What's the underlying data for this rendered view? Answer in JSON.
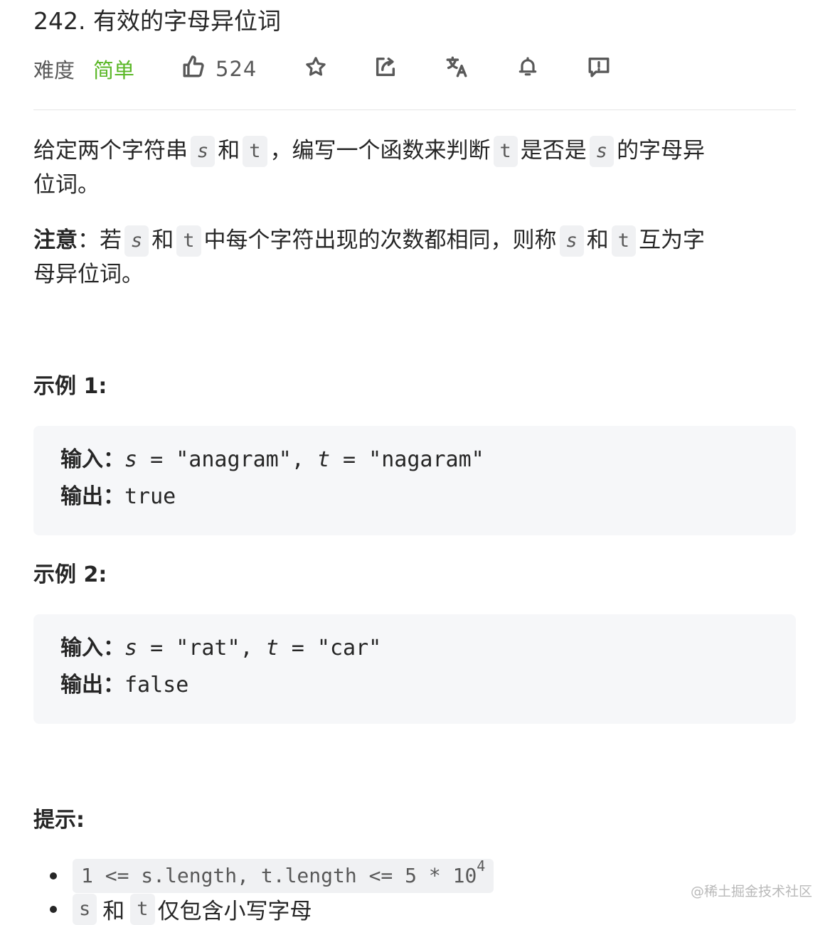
{
  "problem": {
    "title": "242. 有效的字母异位词"
  },
  "meta": {
    "difficulty_label": "难度",
    "difficulty_value": "简单",
    "likes": "524",
    "difficulty_color": "#5ab726"
  },
  "description": {
    "p1_a": "给定两个字符串",
    "p1_s": "s",
    "p1_and": "和",
    "p1_t": "t",
    "p1_b": "，编写一个函数来判断",
    "p1_t2": "t",
    "p1_c": "是否是",
    "p1_s2": "s",
    "p1_d": "的字母异",
    "p1_e": "位词。",
    "p2_note": "注意",
    "p2_colon": "：若",
    "p2_s": "s",
    "p2_and": "和",
    "p2_t": "t",
    "p2_a": "中每个字符出现的次数都相同，则称",
    "p2_s2": "s",
    "p2_and2": "和",
    "p2_t2": "t",
    "p2_b": "互为字",
    "p2_c": "母异位词。"
  },
  "examples": [
    {
      "title": "示例 1:",
      "input_label": "输入：",
      "s_var": "s",
      "t_var": "t",
      "s_value": " = \"anagram\", ",
      "t_value": " = \"nagaram\"",
      "output_label": "输出：",
      "output": "true"
    },
    {
      "title": "示例 2:",
      "input_label": "输入：",
      "s_var": "s",
      "t_var": "t",
      "s_value": " = \"rat\", ",
      "t_value": " = \"car\"",
      "output_label": "输出：",
      "output": "false"
    }
  ],
  "hints": {
    "title": "提示:",
    "constraint_1": "1 <= s.length, t.length <= 5 * 10",
    "constraint_1_exp": "4",
    "item2_s": "s",
    "item2_and": "和",
    "item2_t": "t",
    "item2_text": "仅包含小写字母"
  },
  "watermark": "@稀土掘金技术社区"
}
